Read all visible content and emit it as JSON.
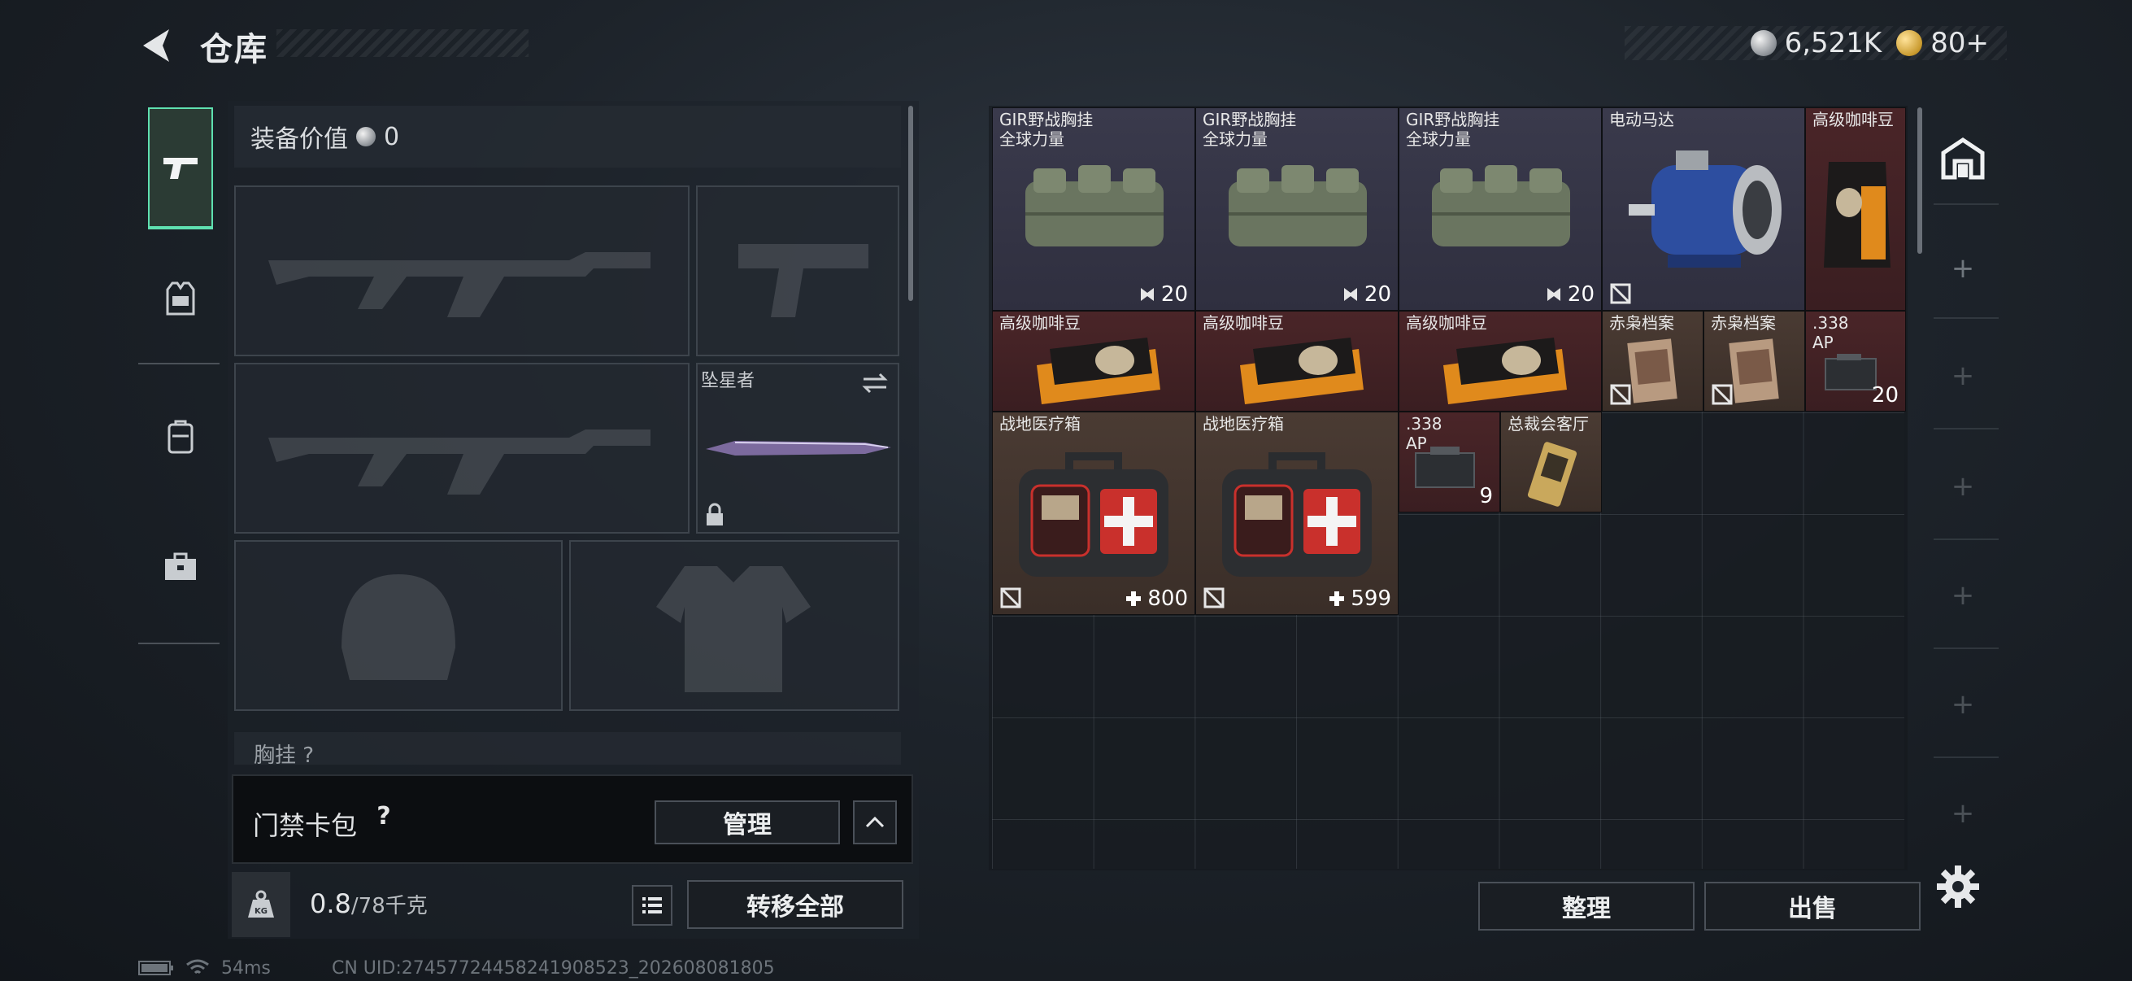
{
  "header": {
    "title": "仓库",
    "currencies": [
      {
        "icon": "silver-coin-icon",
        "value": "6,521K"
      },
      {
        "icon": "gold-coin-icon",
        "value": "80+"
      }
    ]
  },
  "equipment": {
    "value_label": "装备价值",
    "value": "0",
    "melee_name": "坠星者",
    "chest_label": "胸挂 ?",
    "keycard_label": "门禁卡包",
    "keycard_help": "?",
    "manage_label": "管理",
    "weight_value": "0.8",
    "weight_max": "/78千克",
    "transfer_label": "转移全部"
  },
  "storage": {
    "items": [
      {
        "name": "GIR野战胸挂\n全球力量",
        "count": "20",
        "rarity": "purple"
      },
      {
        "name": "GIR野战胸挂\n全球力量",
        "count": "20",
        "rarity": "purple"
      },
      {
        "name": "GIR野战胸挂\n全球力量",
        "count": "20",
        "rarity": "purple"
      },
      {
        "name": "电动马达",
        "count": "",
        "rarity": "purple"
      },
      {
        "name": "高级咖啡豆",
        "count": "",
        "rarity": "red"
      },
      {
        "name": "高级咖啡豆",
        "count": "",
        "rarity": "red"
      },
      {
        "name": "高级咖啡豆",
        "count": "",
        "rarity": "red"
      },
      {
        "name": "高级咖啡豆",
        "count": "",
        "rarity": "red"
      },
      {
        "name": "赤枭档案",
        "count": "",
        "rarity": "brown"
      },
      {
        "name": "赤枭档案",
        "count": "",
        "rarity": "brown"
      },
      {
        "name": ".338\nAP",
        "count": "20",
        "rarity": "red"
      },
      {
        "name": "战地医疗箱",
        "count": "800",
        "rarity": "brown"
      },
      {
        "name": "战地医疗箱",
        "count": "599",
        "rarity": "brown"
      },
      {
        "name": ".338\nAP",
        "count": "9",
        "rarity": "red"
      },
      {
        "name": "总裁会客厅",
        "count": "",
        "rarity": "brown"
      }
    ],
    "sort_label": "整理",
    "sell_label": "出售"
  },
  "status": {
    "ping": "54ms",
    "uid": "CN UID:27457724458241908523_202608081805"
  },
  "colors": {
    "accent": "#5fe0b0",
    "rarity_purple": "#3a3a4c",
    "rarity_red": "#4a2528",
    "rarity_brown": "#4a3b33"
  }
}
